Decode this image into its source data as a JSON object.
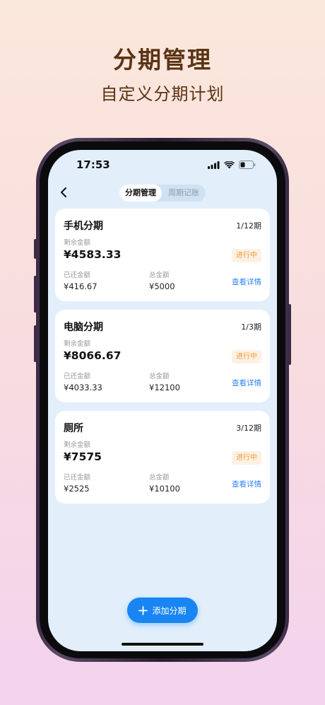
{
  "promo": {
    "title": "分期管理",
    "subtitle": "自定义分期计划"
  },
  "status_bar": {
    "time": "17:53"
  },
  "nav": {
    "tabs": [
      "分期管理",
      "周期记账"
    ],
    "active_tab": "分期管理"
  },
  "cards": [
    {
      "name": "手机分期",
      "period": "1/12期",
      "remain_label": "剩余金额",
      "remain": "¥4583.33",
      "status": "进行中",
      "paid_label": "已还金额",
      "paid": "¥416.67",
      "total_label": "总金额",
      "total": "¥5000",
      "detail": "查看详情"
    },
    {
      "name": "电脑分期",
      "period": "1/3期",
      "remain_label": "剩余金额",
      "remain": "¥8066.67",
      "status": "进行中",
      "paid_label": "已还金额",
      "paid": "¥4033.33",
      "total_label": "总金额",
      "total": "¥12100",
      "detail": "查看详情"
    },
    {
      "name": "厕所",
      "period": "3/12期",
      "remain_label": "剩余金额",
      "remain": "¥7575",
      "status": "进行中",
      "paid_label": "已还金额",
      "paid": "¥2525",
      "total_label": "总金额",
      "total": "¥10100",
      "detail": "查看详情"
    }
  ],
  "add_button": {
    "label": "添加分期",
    "icon": "plus-icon"
  },
  "colors": {
    "accent": "#1885f3",
    "status_orange": "#f39a3c",
    "title_brown": "#5b3414"
  }
}
